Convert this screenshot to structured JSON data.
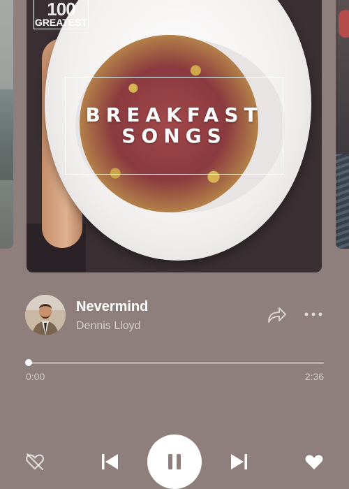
{
  "album": {
    "logo_number": "100",
    "logo_text": "GREATEST",
    "title_line1": "BREAKFAST",
    "title_line2": "SONGS"
  },
  "track": {
    "title": "Nevermind",
    "artist": "Dennis Lloyd"
  },
  "progress": {
    "current": "0:00",
    "total": "2:36",
    "fraction": 0.0
  },
  "icons": {
    "share": "share-icon",
    "more": "more-icon",
    "dislike": "heart-crossed-icon",
    "previous": "previous-icon",
    "pause": "pause-icon",
    "next": "next-icon",
    "like": "heart-icon"
  },
  "colors": {
    "background": "#8f7f7c",
    "accent": "#ffffff"
  }
}
